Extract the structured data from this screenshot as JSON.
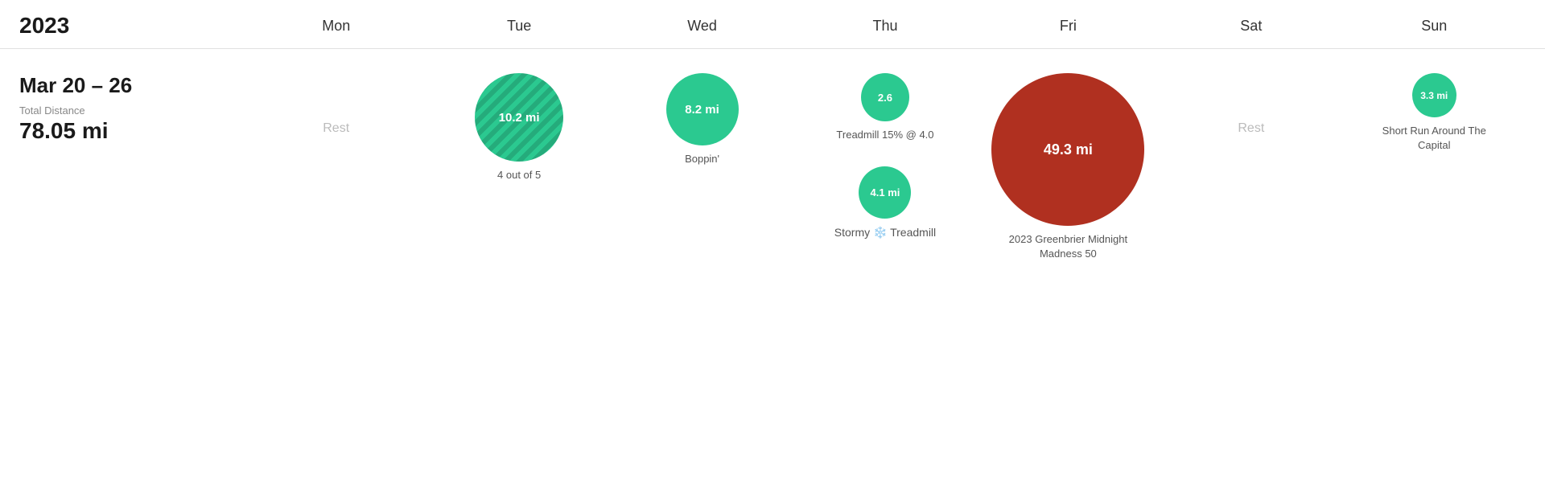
{
  "year": "2023",
  "days": [
    "Mon",
    "Tue",
    "Wed",
    "Thu",
    "Fri",
    "Sat",
    "Sun"
  ],
  "week": {
    "range": "Mar 20 – 26",
    "total_label": "Total Distance",
    "total_distance": "78.05 mi"
  },
  "columns": [
    {
      "day": "Mon",
      "type": "rest",
      "rest_label": "Rest",
      "activities": []
    },
    {
      "day": "Tue",
      "type": "activity",
      "activities": [
        {
          "distance": "10.2 mi",
          "size": 110,
          "style": "striped",
          "label": "4 out of 5"
        }
      ]
    },
    {
      "day": "Wed",
      "type": "activity",
      "activities": [
        {
          "distance": "8.2 mi",
          "size": 90,
          "style": "green",
          "label": "Boppin'"
        }
      ]
    },
    {
      "day": "Thu",
      "type": "activity",
      "activities": [
        {
          "distance": "2.6",
          "size": 60,
          "style": "green",
          "label": "Treadmill 15% @ 4.0"
        },
        {
          "distance": "4.1 mi",
          "size": 65,
          "style": "green",
          "label": "Stormy 🌨️ Treadmill",
          "stormy": true
        }
      ]
    },
    {
      "day": "Fri",
      "type": "activity",
      "activities": [
        {
          "distance": "49.3 mi",
          "size": 190,
          "style": "red",
          "label": "2023 Greenbrier Midnight Madness 50"
        }
      ]
    },
    {
      "day": "Sat",
      "type": "rest",
      "rest_label": "Rest",
      "activities": []
    },
    {
      "day": "Sun",
      "type": "activity",
      "activities": [
        {
          "distance": "3.3 mi",
          "size": 55,
          "style": "green",
          "label": "Short Run Around The Capital"
        }
      ]
    }
  ]
}
